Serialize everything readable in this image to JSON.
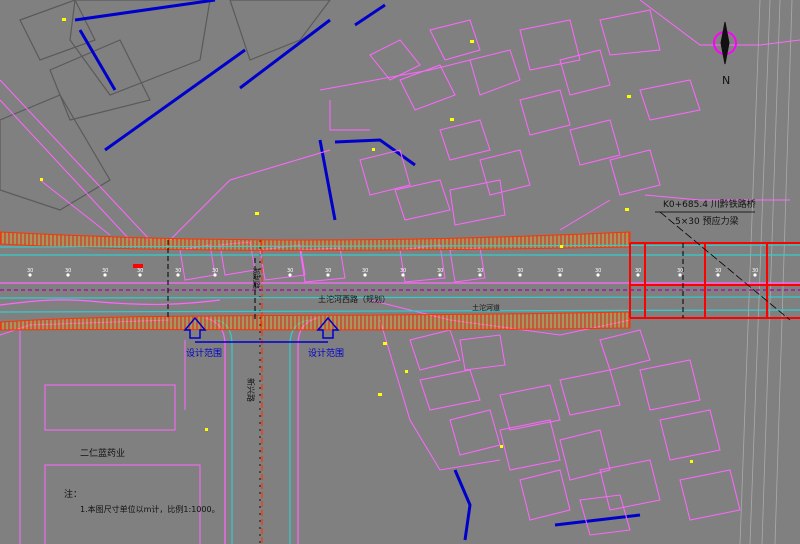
{
  "drawing": {
    "background": "#808080",
    "colors": {
      "magenta": "#ff66ff",
      "cyan": "#33cccc",
      "blue": "#0000cc",
      "red": "#ff0000",
      "yellow": "#ffff00",
      "white": "#ffffff",
      "darkgray": "#5a5a5a"
    }
  },
  "north_arrow": {
    "label": "N",
    "icon": "north-arrow-icon"
  },
  "bridge_note": {
    "line1": "K0+685.4 川黔铁路桥",
    "line2": "5×30 预应力梁"
  },
  "design_range": {
    "left": "设计范围",
    "right": "设计范围"
  },
  "road_names": {
    "main_road": "土沱河西路（规划）",
    "cross_road": "新兴路",
    "cross_road_center": "规划路"
  },
  "existing_road_label": "土沱河道",
  "area_label": "二仁蓝药业",
  "notes": {
    "title": "注：",
    "line1": "1.本图尺寸单位以m计，比例1:1000。"
  },
  "station_markers": {
    "label": "30"
  }
}
